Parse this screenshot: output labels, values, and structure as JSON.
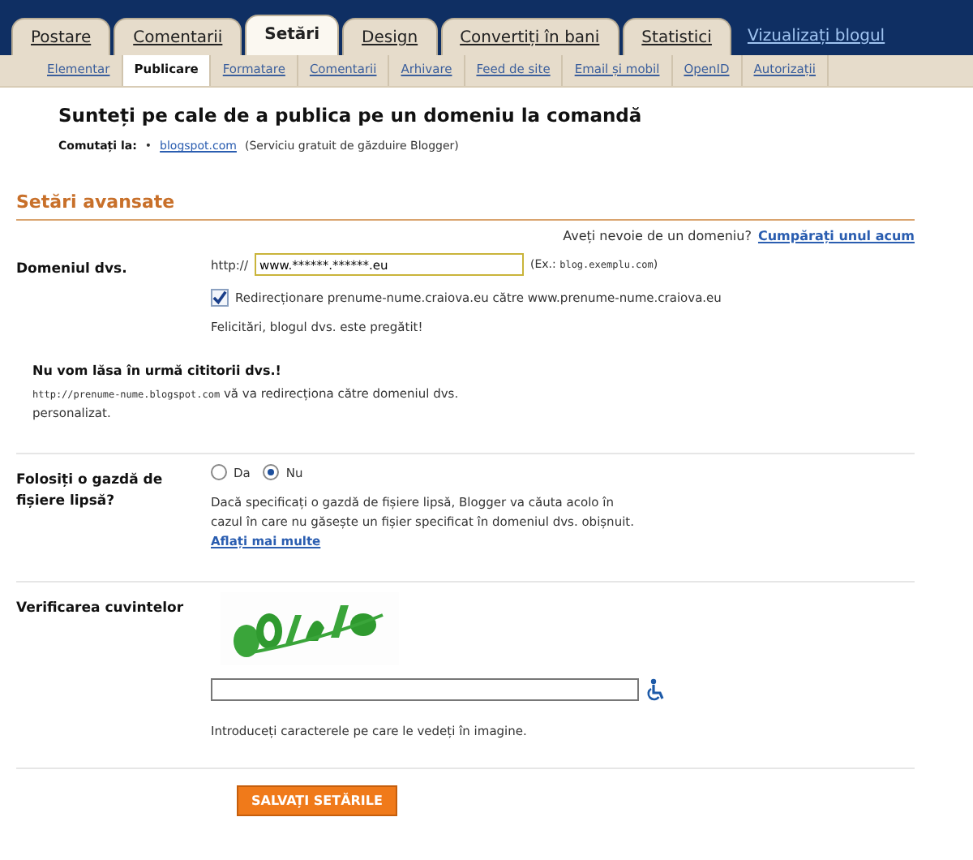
{
  "tabs": [
    {
      "label": "Postare",
      "selected": false
    },
    {
      "label": "Comentarii",
      "selected": false
    },
    {
      "label": "Setări",
      "selected": true
    },
    {
      "label": "Design",
      "selected": false
    },
    {
      "label": "Convertiți în bani",
      "selected": false
    },
    {
      "label": "Statistici",
      "selected": false
    }
  ],
  "view_blog_link": "Vizualizați blogul",
  "subtabs": [
    {
      "label": "Elementar",
      "selected": false
    },
    {
      "label": "Publicare",
      "selected": true
    },
    {
      "label": "Formatare",
      "selected": false
    },
    {
      "label": "Comentarii",
      "selected": false
    },
    {
      "label": "Arhivare",
      "selected": false
    },
    {
      "label": "Feed de site",
      "selected": false
    },
    {
      "label": "Email și mobil",
      "selected": false
    },
    {
      "label": "OpenID",
      "selected": false
    },
    {
      "label": "Autorizații",
      "selected": false
    }
  ],
  "heading": "Sunteți pe cale de a publica pe un domeniu la comandă",
  "switch": {
    "label": "Comutați la:",
    "bullet": "•",
    "link": "blogspot.com",
    "note": "(Serviciu gratuit de găzduire Blogger)"
  },
  "advanced": {
    "title": "Setări avansate",
    "need_domain": "Aveți nevoie de un domeniu?",
    "buy_link": "Cumpărați unul acum"
  },
  "domain": {
    "label": "Domeniul dvs.",
    "prefix": "http://",
    "value": "www.******.******.eu",
    "example_prefix": "(Ex.:",
    "example": "blog.exemplu.com",
    "example_suffix": ")",
    "redirect": {
      "label": "Redirecționare prenume-nume.craiova.eu către www.prenume-nume.craiova.eu",
      "checked": true
    },
    "success": "Felicitări, blogul dvs. este pregătit!"
  },
  "readers": {
    "title": "Nu vom lăsa în urmă cititorii dvs.!",
    "url": "http://prenume-nume.blogspot.com",
    "text": "vă va redirecționa către domeniul dvs. personalizat."
  },
  "missing_host": {
    "label": "Folosiți o gazdă de fișiere lipsă?",
    "options": [
      {
        "label": "Da",
        "selected": false
      },
      {
        "label": "Nu",
        "selected": true
      }
    ],
    "help": "Dacă specificați o gazdă de fișiere lipsă, Blogger va căuta acolo în cazul în care nu găsește un fișier specificat în domeniul dvs. obișnuit.",
    "help_link": "Aflați mai multe"
  },
  "word_verification": {
    "label": "Verificarea cuvintelor",
    "hint": "Introduceți caracterele pe care le vedeți în imagine."
  },
  "save_button": "SALVAȚI SETĂRILE"
}
